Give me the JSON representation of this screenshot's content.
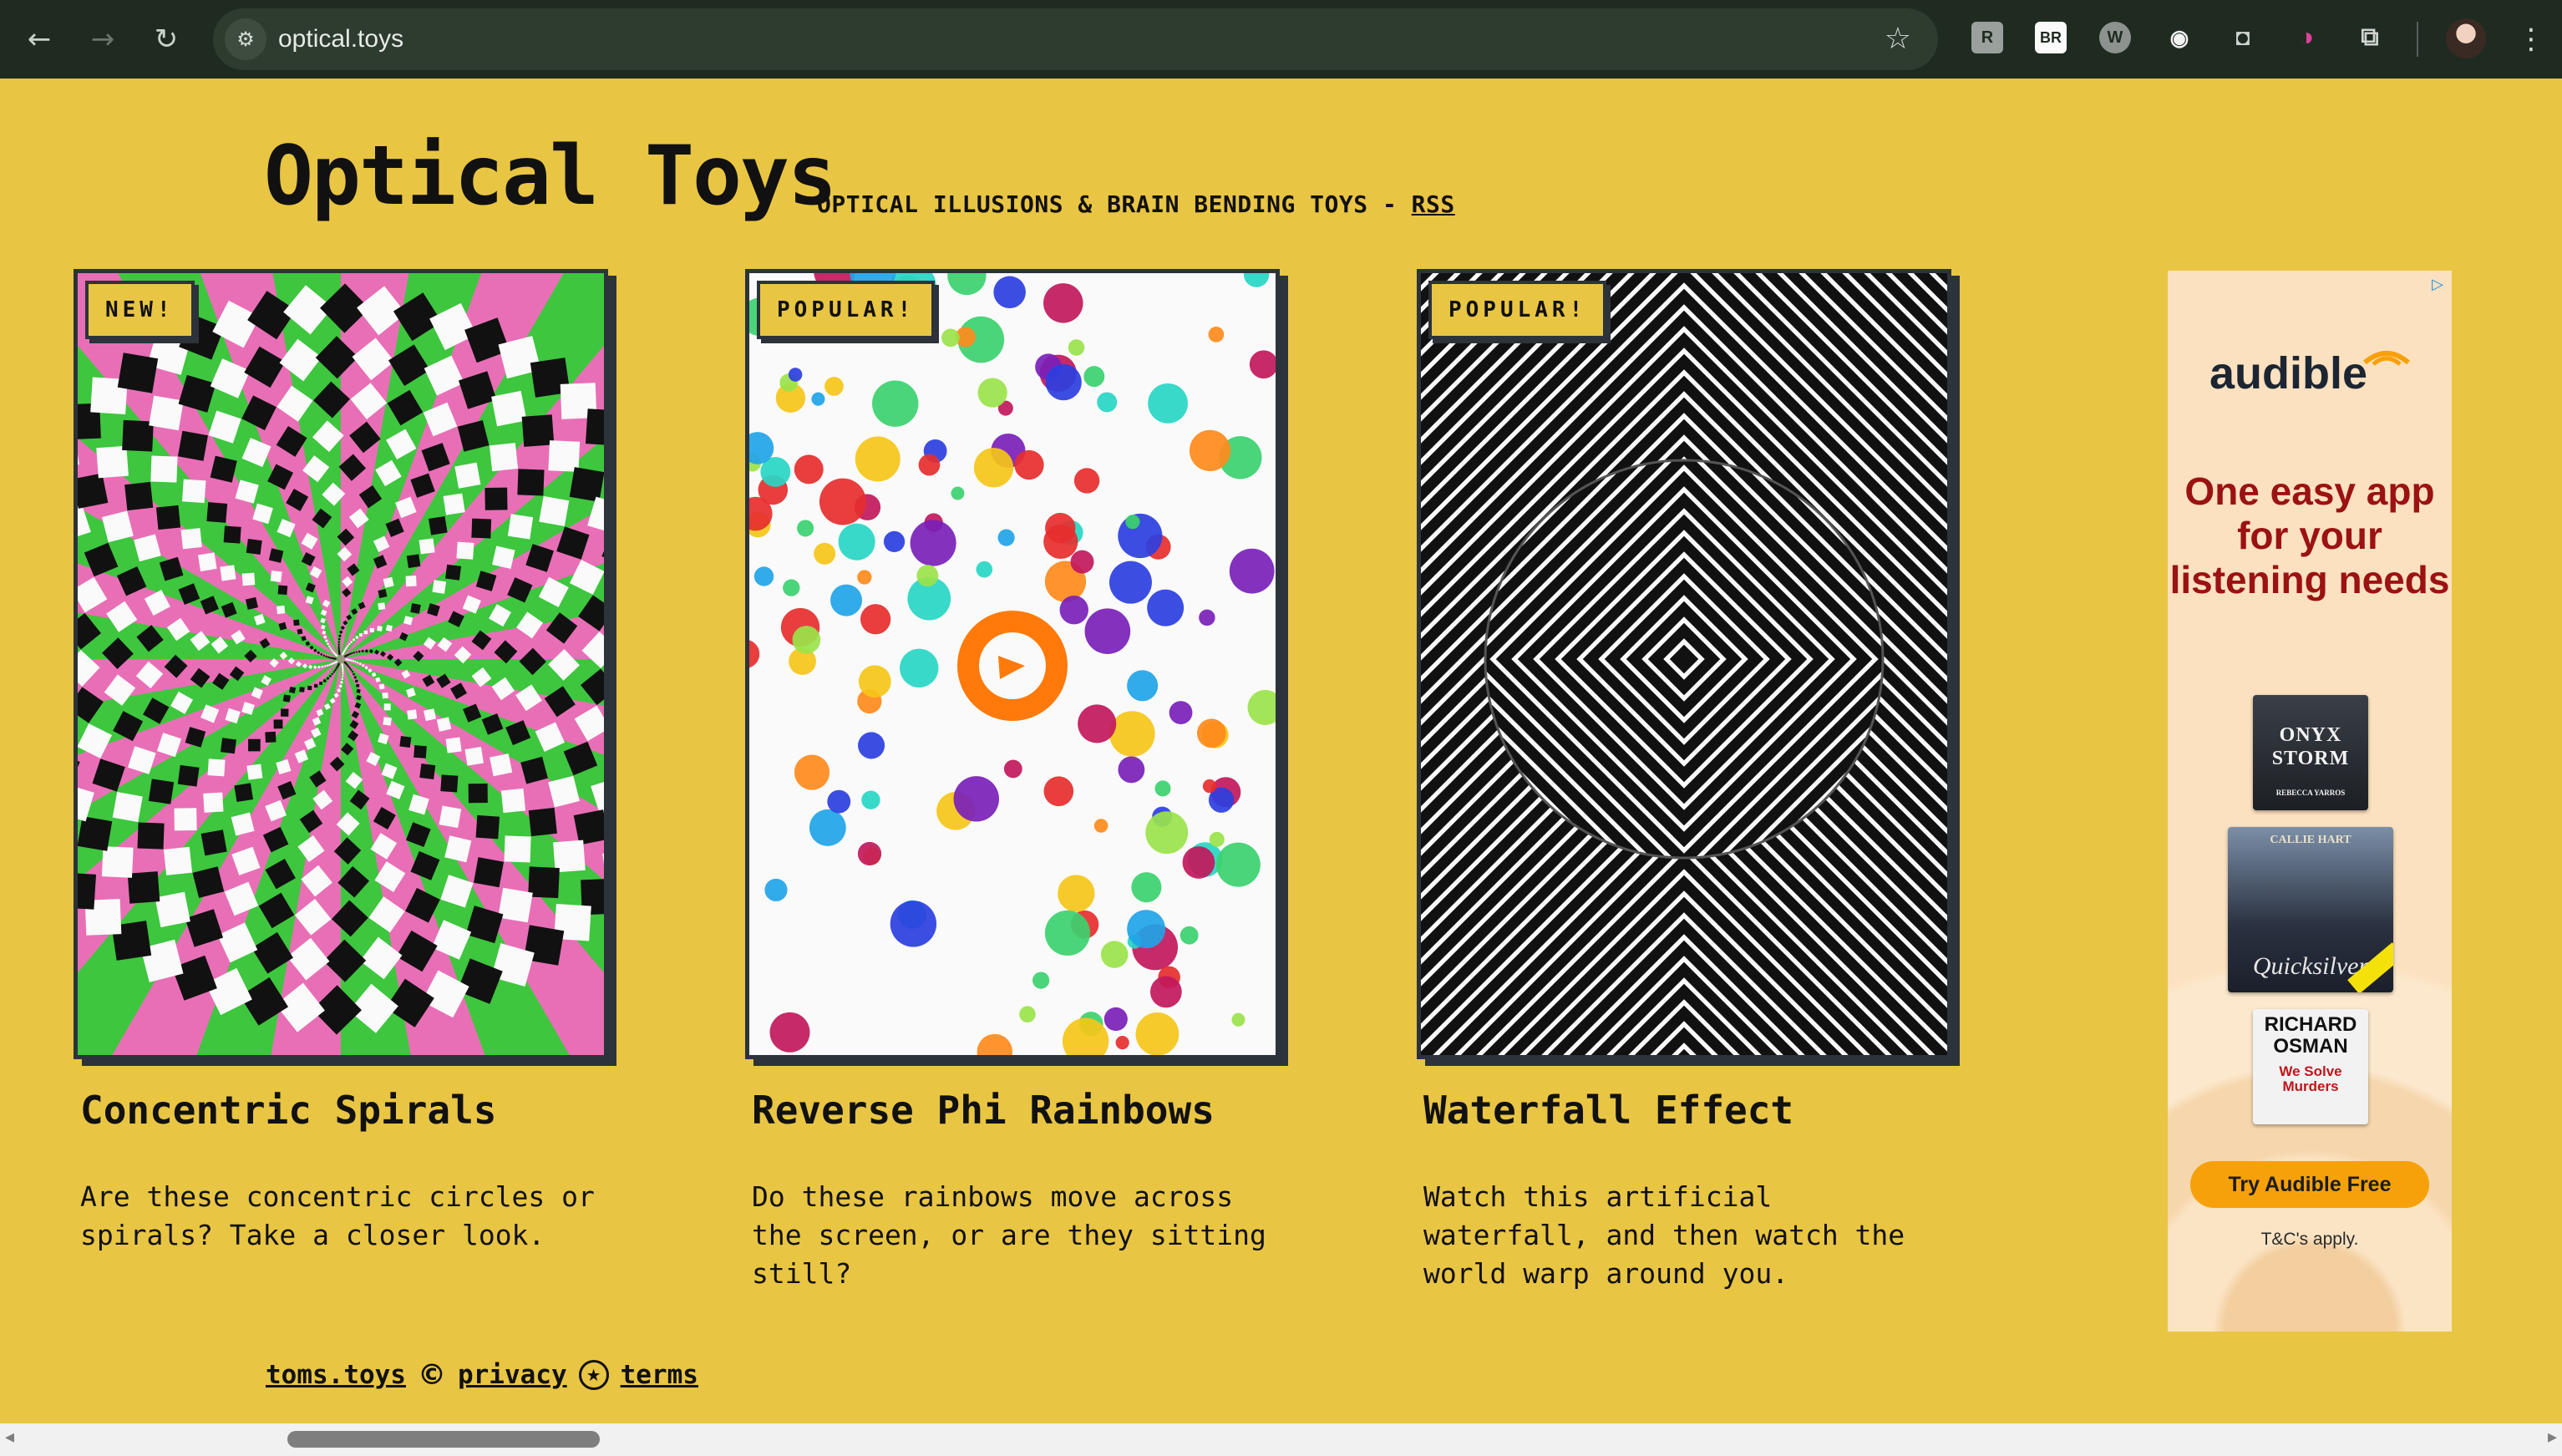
{
  "browser": {
    "url": "optical.toys",
    "back_icon": "←",
    "forward_icon": "→",
    "reload_icon": "↻",
    "site_info_icon": "⚙",
    "bookmark_icon": "☆",
    "menu_icon": "⋮",
    "extensions": [
      {
        "name": "readwise-icon",
        "glyph": "R"
      },
      {
        "name": "br-icon",
        "glyph": "BR"
      },
      {
        "name": "w-icon",
        "glyph": "W"
      },
      {
        "name": "eye-icon",
        "glyph": "◉"
      },
      {
        "name": "camera-icon",
        "glyph": "◘"
      },
      {
        "name": "color-picker-icon",
        "glyph": "◑"
      },
      {
        "name": "puzzle-icon",
        "glyph": "⧉"
      }
    ]
  },
  "header": {
    "title": "Optical Toys",
    "tagline": "OPTICAL ILLUSIONS & BRAIN BENDING TOYS - ",
    "rss_label": "RSS"
  },
  "cards": [
    {
      "badge": "NEW!",
      "title": "Concentric Spirals",
      "description": "Are these concentric circles or spirals? Take a closer look."
    },
    {
      "badge": "POPULAR!",
      "title": "Reverse Phi Rainbows",
      "description": "Do these rainbows move across the screen, or are they sitting still?"
    },
    {
      "badge": "POPULAR!",
      "title": "Waterfall Effect",
      "description": "Watch this artificial waterfall, and then watch the world warp around you."
    }
  ],
  "ad": {
    "logo": "audible",
    "headline": "One easy app for your listening needs",
    "books": [
      {
        "title": "ONYX STORM",
        "author": "REBECCA YARROS"
      },
      {
        "title": "Quicksilver",
        "author": "CALLIE HART"
      },
      {
        "title": "RICHARD OSMAN",
        "subtitle": "We Solve Murders"
      }
    ],
    "cta": "Try Audible Free",
    "terms": "T&C's apply.",
    "adchoices_icon": "▷"
  },
  "footer": {
    "home_link": "toms.toys",
    "copyright_symbol": "©",
    "privacy_link": "privacy",
    "star_symbol": "★",
    "terms_link": "terms"
  },
  "colors": {
    "page_bg": "#e9c544",
    "chrome_bg": "#1f2b20",
    "border": "#2c333a",
    "ad_red": "#9b1212",
    "ad_orange": "#f7a10a"
  }
}
